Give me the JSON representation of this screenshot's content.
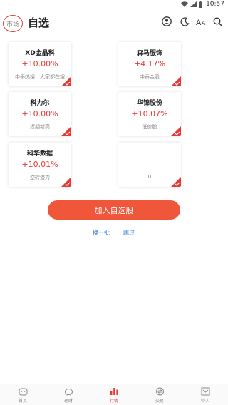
{
  "status_bar": {
    "time": "10:57"
  },
  "header": {
    "market_label": "市场",
    "title": "自选"
  },
  "stocks": [
    {
      "name": "XD金晶科",
      "change": "+10.00%",
      "tag": "中泰热搜，大家都在搜"
    },
    {
      "name": "森马服饰",
      "change": "+4.17%",
      "tag": "中泰金股"
    },
    {
      "name": "科力尔",
      "change": "+10.00%",
      "tag": "近期新高"
    },
    {
      "name": "华锦股份",
      "change": "+10.07%",
      "tag": "低价股"
    },
    {
      "name": "科华数据",
      "change": "+10.01%",
      "tag": "逆转潜力"
    },
    {
      "name": "",
      "change": "",
      "tag": "0"
    }
  ],
  "actions": {
    "add_label": "加入自选股",
    "refresh_label": "换一批",
    "skip_label": "跳过"
  },
  "nav": {
    "items": [
      {
        "label": "首页",
        "icon": "home-icon"
      },
      {
        "label": "理财",
        "icon": "piggy-bank-icon"
      },
      {
        "label": "行情",
        "icon": "bar-chart-icon",
        "active": true
      },
      {
        "label": "交易",
        "icon": "exchange-icon"
      },
      {
        "label": "中人",
        "icon": "person-icon"
      }
    ]
  },
  "colors": {
    "accent": "#e53935",
    "button": "#f0573a",
    "link": "#2f7ad8"
  }
}
